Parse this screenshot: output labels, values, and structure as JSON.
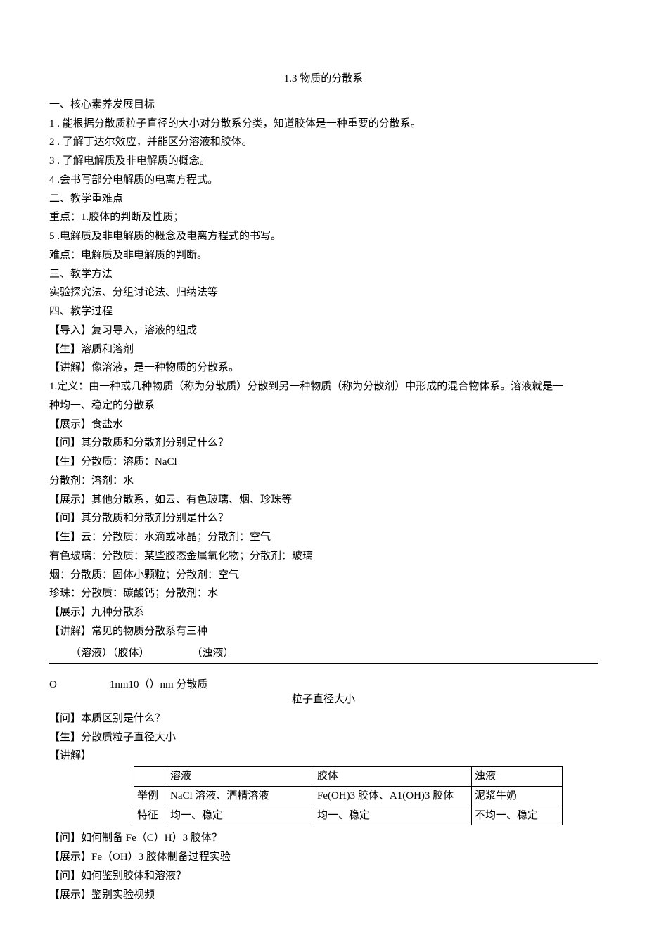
{
  "title": "1.3 物质的分散系",
  "section1": {
    "heading": "一、核心素养发展目标",
    "item1": "1  . 能根据分散质粒子直径的大小对分散系分类，知道胶体是一种重要的分散系。",
    "item2": "2  . 了解丁达尔效应，并能区分溶液和胶体。",
    "item3": "3  . 了解电解质及非电解质的概念。",
    "item4": "4  .会书写部分电解质的电离方程式。"
  },
  "section2": {
    "heading": "二、教学重难点",
    "line_zd": "重点：1.胶体的判断及性质；",
    "line5": "5  .电解质及非电解质的概念及电离方程式的书写。",
    "line_nd": "难点：电解质及非电解质的判断。"
  },
  "section3": {
    "heading": "三、教学方法",
    "content": "实验探究法、分组讨论法、归纳法等"
  },
  "section4": {
    "heading": "四、教学过程",
    "l1": "【导入】复习导入，溶液的组成",
    "l2": "【生】溶质和溶剂",
    "l3": "【讲解】像溶液，是一种物质的分散系。",
    "l4": "1.定义：由一种或几种物质（称为分散质）分散到另一种物质（称为分散剂）中形成的混合物体系。溶液就是一",
    "l5": "种均一、稳定的分散系",
    "l6": "【展示】食盐水",
    "l7": "【问】其分散质和分散剂分别是什么？",
    "l8": "【生】分散质：溶质：NaCl",
    "l9": "分散剂：溶剂：水",
    "l10": "【展示】其他分散系，如云、有色玻璃、烟、珍珠等",
    "l11": "【问】其分散质和分散剂分别是什么？",
    "l12": "【生】云：分散质：水滴或冰晶；分散剂：空气",
    "l13": "有色玻璃：分散质：某些胶态金属氧化物；分散剂：玻璃",
    "l14": "烟：分散质：固体小颗粒；分散剂：空气",
    "l15": "珍珠：分散质：碳酸钙；分散剂：水",
    "l16": "【展示】九种分散系",
    "l17": "【讲解】常见的物质分散系有三种"
  },
  "axis": {
    "labels": "（溶液）（胶体）    （浊液）",
    "under": "O     1nm10（）nm 分散质",
    "caption": "粒子直径大小"
  },
  "post": {
    "p1": "【问】本质区别是什么？",
    "p2": "【生】分散质粒子直径大小",
    "p3": "【讲解】"
  },
  "table": {
    "r0c0": "",
    "r0c1": "溶液",
    "r0c2": "胶体",
    "r0c3": "浊液",
    "r1c0": "举例",
    "r1c1": "NaCl 溶液、酒精溶液",
    "r1c2": "Fe(OH)3 胶体、A1(OH)3 胶体",
    "r1c3": "泥浆牛奶",
    "r2c0": "特征",
    "r2c1": "均一、稳定",
    "r2c2": "均一、稳定",
    "r2c3": "不均一、稳定"
  },
  "tail": {
    "t1": "【问】如何制备 Fe（C）H）3 胶体？",
    "t2": "【展示】Fe（OH）3 胶体制备过程实验",
    "t3": "【问】如何鉴别胶体和溶液？",
    "t4": "【展示】鉴别实验视频"
  }
}
